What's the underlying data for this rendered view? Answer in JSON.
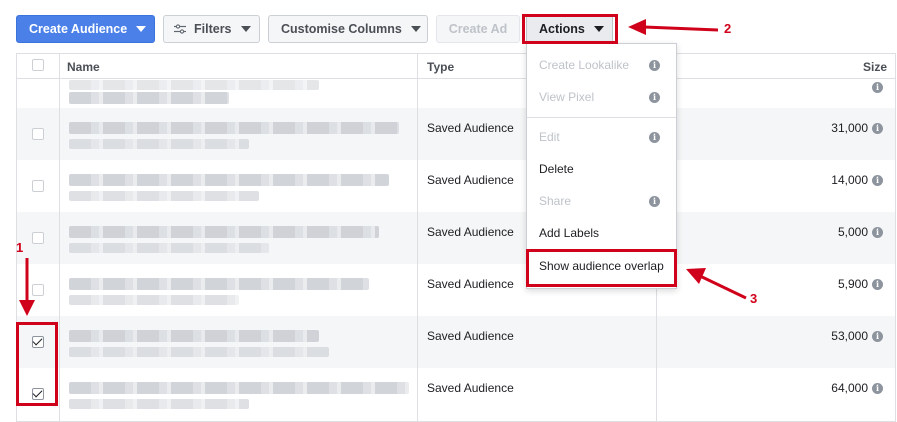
{
  "toolbar": {
    "create_audience": "Create Audience",
    "filters": "Filters",
    "customise_columns": "Customise Columns",
    "create_ad": "Create Ad",
    "actions": "Actions"
  },
  "table": {
    "headers": {
      "name": "Name",
      "type": "Type",
      "size": "Size"
    },
    "rows": [
      {
        "type": "",
        "size": "",
        "checked": false
      },
      {
        "type": "Saved Audience",
        "size": "31,000",
        "checked": false
      },
      {
        "type": "Saved Audience",
        "size": "14,000",
        "checked": false
      },
      {
        "type": "Saved Audience",
        "size": "5,000",
        "checked": false
      },
      {
        "type": "Saved Audience",
        "size": "5,900",
        "checked": false
      },
      {
        "type": "Saved Audience",
        "size": "53,000",
        "checked": true
      },
      {
        "type": "Saved Audience",
        "size": "64,000",
        "checked": true
      }
    ]
  },
  "actions_menu": {
    "items": [
      {
        "label": "Create Lookalike",
        "disabled": true,
        "info": true
      },
      {
        "label": "View Pixel",
        "disabled": true,
        "info": true
      },
      {
        "label": "Edit",
        "disabled": true,
        "info": true
      },
      {
        "label": "Delete",
        "disabled": false,
        "info": false
      },
      {
        "label": "Share",
        "disabled": true,
        "info": true
      },
      {
        "label": "Add Labels",
        "disabled": false,
        "info": false
      },
      {
        "label": "Show audience overlap",
        "disabled": false,
        "info": false
      }
    ]
  },
  "annotations": {
    "step1": "1",
    "step2": "2",
    "step3": "3",
    "color": "#d0021b"
  },
  "info_glyph": "i"
}
